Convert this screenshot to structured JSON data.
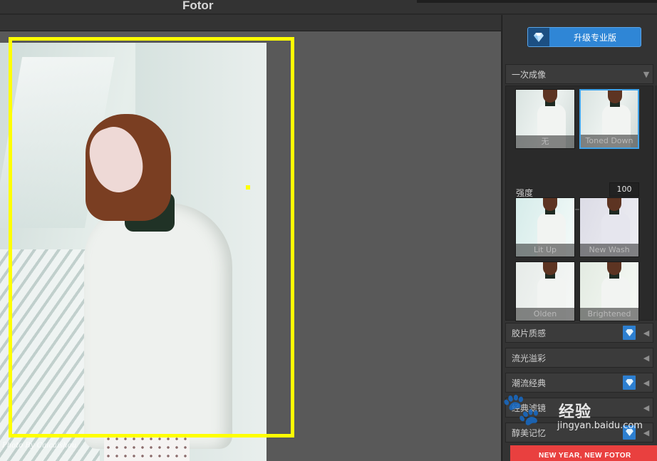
{
  "app": {
    "title": "Fotor"
  },
  "canvas": {
    "watermark": "Photo By Caicaishou"
  },
  "panel": {
    "upgrade_label": "升级专业版",
    "sections": [
      {
        "label": "一次成像",
        "expanded": true,
        "premium": false
      },
      {
        "label": "胶片质感",
        "expanded": false,
        "premium": true
      },
      {
        "label": "流光溢彩",
        "expanded": false,
        "premium": false
      },
      {
        "label": "潮流经典",
        "expanded": false,
        "premium": true
      },
      {
        "label": "经典滤镜",
        "expanded": false,
        "premium": false
      },
      {
        "label": "醇美记忆",
        "expanded": false,
        "premium": true
      }
    ],
    "filters": [
      "无",
      "Toned Down",
      "Lit Up",
      "New Wash",
      "Olden",
      "Brightened"
    ],
    "selected_filter": "Toned Down",
    "strength": {
      "label": "强度",
      "value": "100",
      "level": 1.0
    }
  },
  "watermark_site": {
    "name": "经验",
    "url": "jingyan.baidu.com"
  },
  "promo": {
    "text": "NEW YEAR, NEW FOTOR"
  },
  "colors": {
    "accent": "#2f86d6",
    "selection": "#ffff00",
    "panel_bg": "#333333",
    "canvas_bg": "#595959"
  }
}
